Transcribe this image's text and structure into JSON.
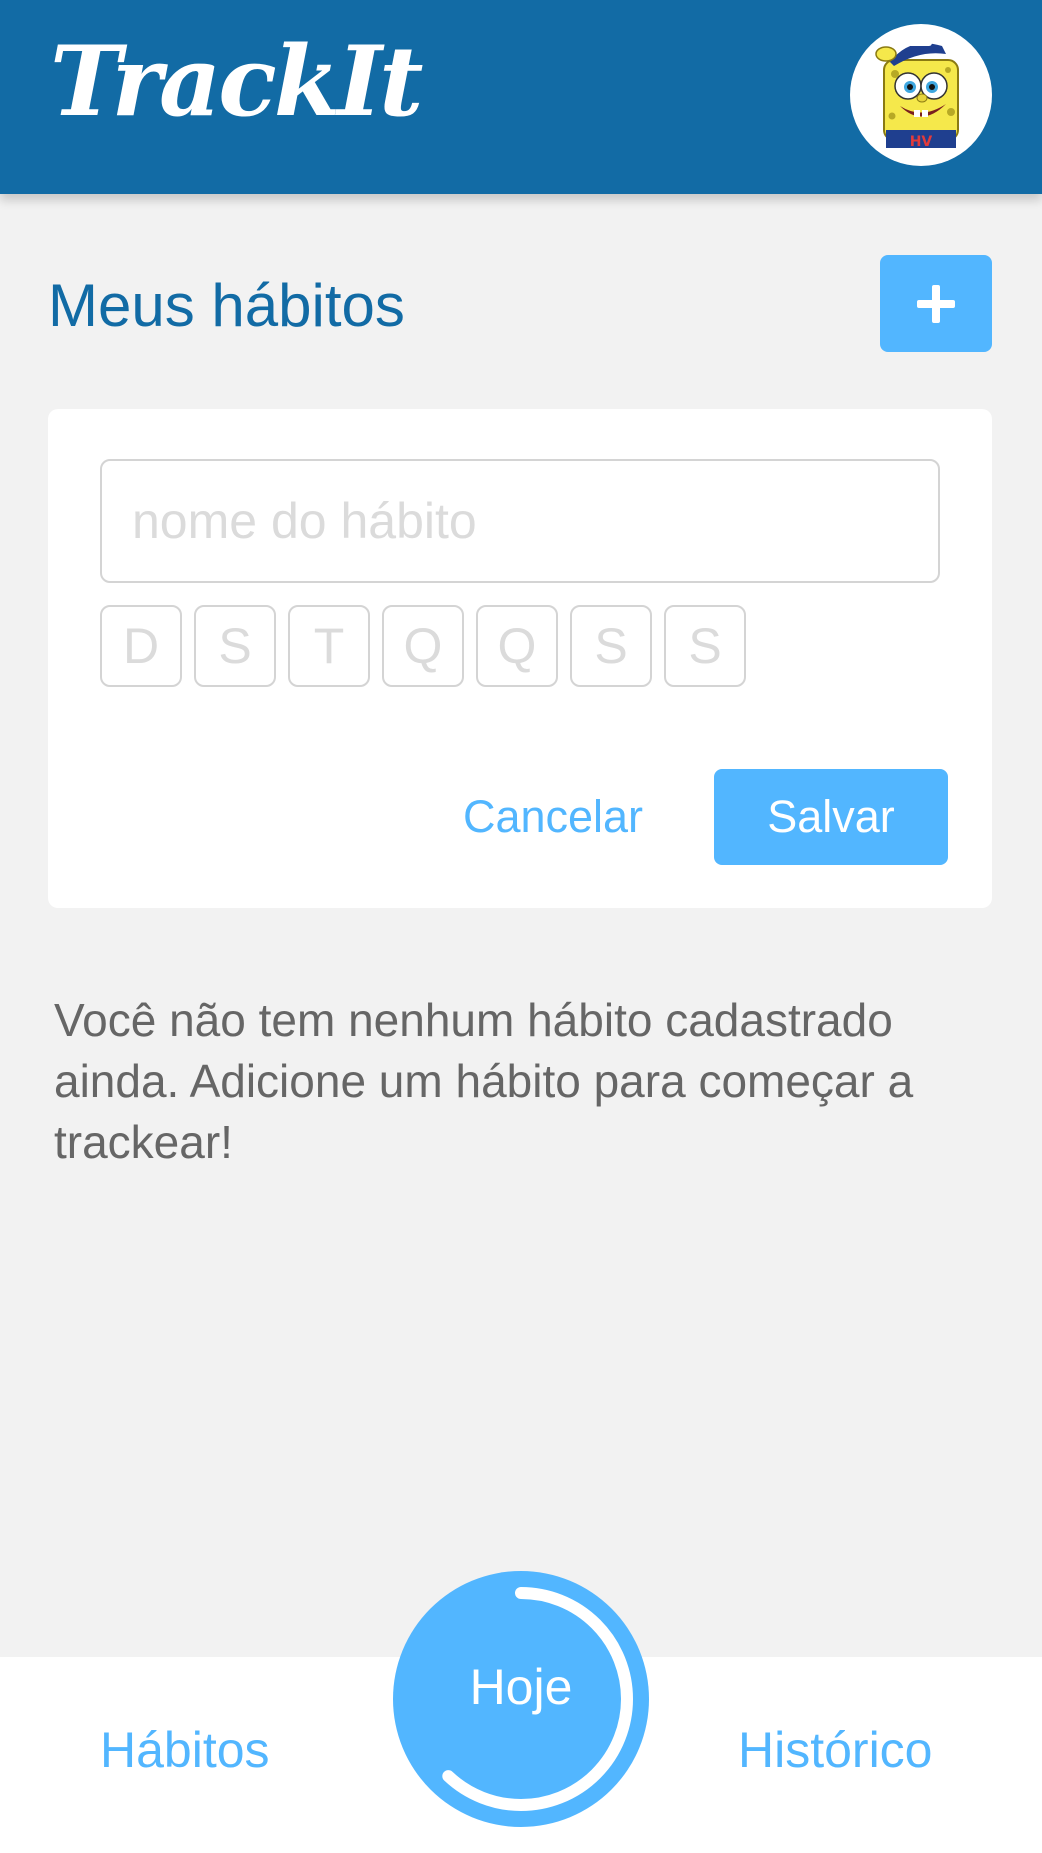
{
  "header": {
    "logo": "TrackIt",
    "avatar_icon": "spongebob-avatar"
  },
  "main": {
    "title": "Meus hábitos",
    "add_button_icon": "plus-icon"
  },
  "new_habit_form": {
    "name_placeholder": "nome do hábito",
    "name_value": "",
    "days": [
      "D",
      "S",
      "T",
      "Q",
      "Q",
      "S",
      "S"
    ],
    "cancel_label": "Cancelar",
    "save_label": "Salvar"
  },
  "empty_message": "Você não tem nenhum hábito cadastrado ainda. Adicione um hábito para começar a trackear!",
  "bottom_nav": {
    "habits_label": "Hábitos",
    "today_label": "Hoje",
    "history_label": "Histórico",
    "today_progress": 0.62
  },
  "colors": {
    "header": "#126ba5",
    "accent": "#52b6ff",
    "background": "#f2f2f2",
    "text": "#666666",
    "placeholder": "#dbdbdb"
  }
}
